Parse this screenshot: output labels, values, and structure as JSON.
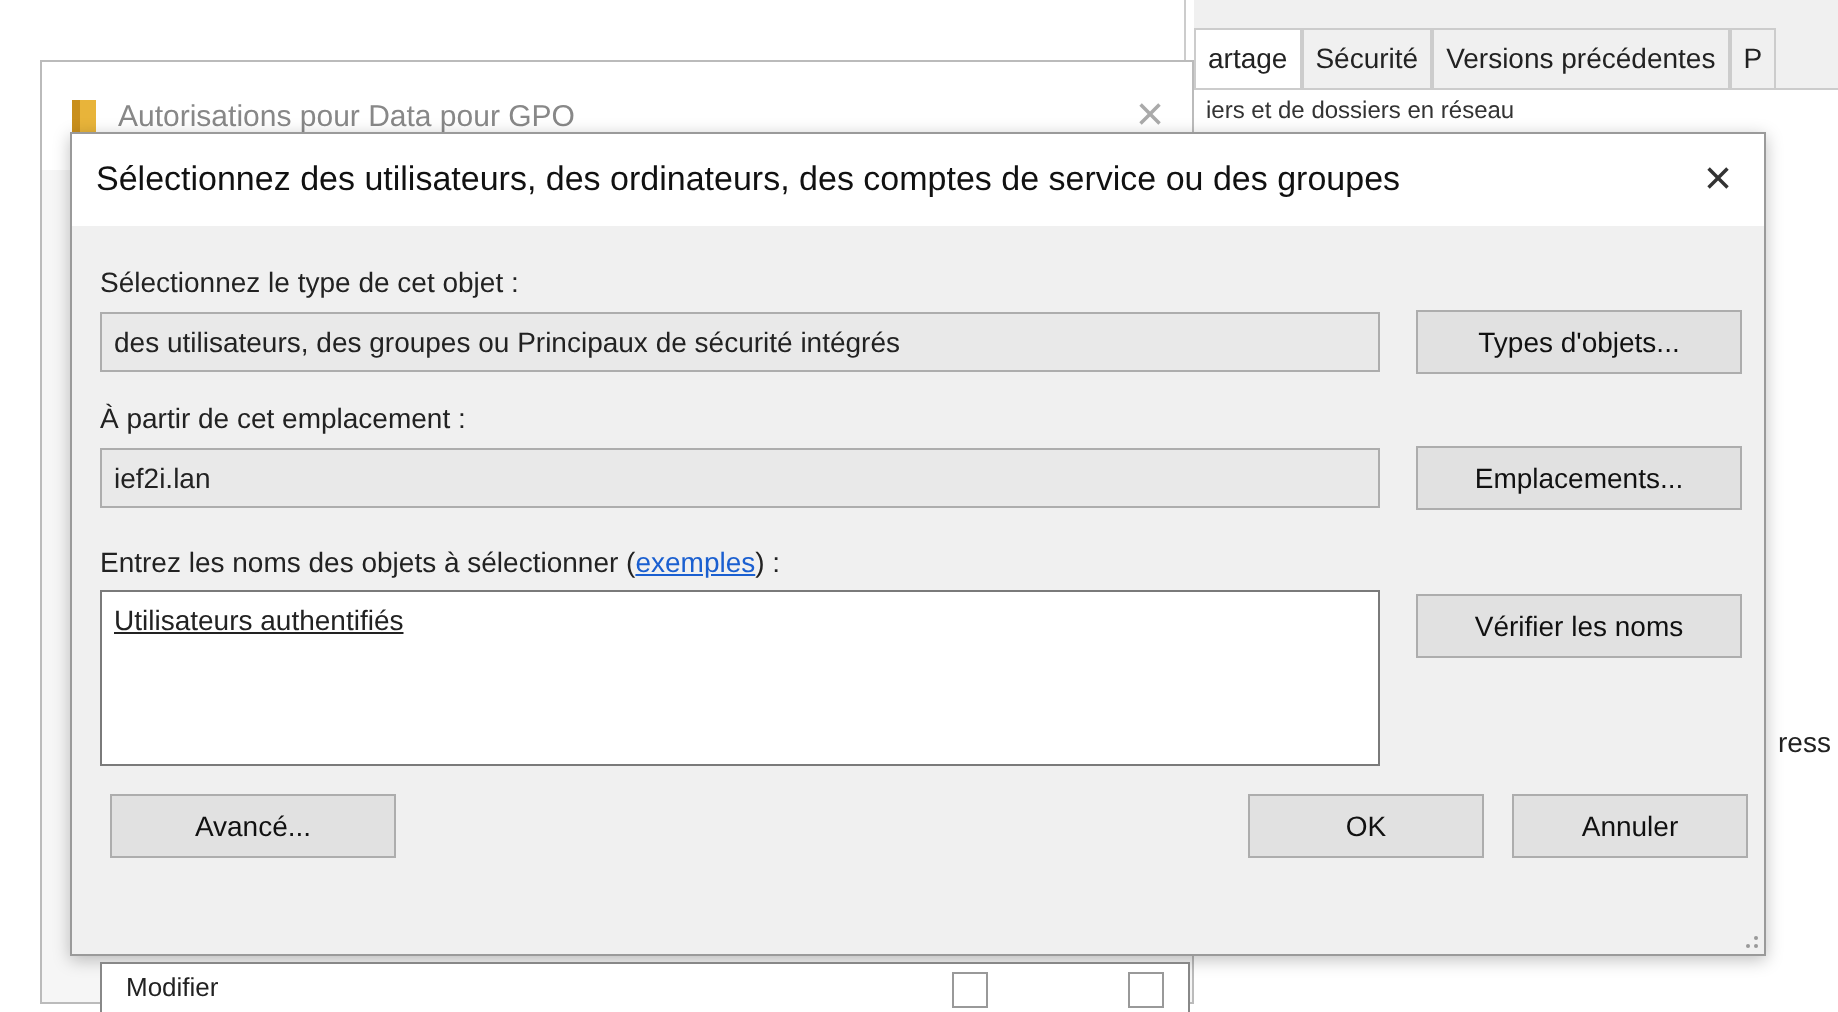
{
  "back_window": {
    "list_item": "Modifier",
    "checkboxes": [
      {
        "checked": false
      },
      {
        "checked": false
      }
    ]
  },
  "properties_window": {
    "tabs": [
      {
        "label": "artage",
        "selected": true
      },
      {
        "label": "Sécurité",
        "selected": false
      },
      {
        "label": "Versions précédentes",
        "selected": false
      },
      {
        "label": "P",
        "selected": false
      }
    ],
    "subtitle": "iers et de dossiers en réseau",
    "side_text": "ress"
  },
  "permissions_window": {
    "title": "Autorisations pour Data pour GPO",
    "close": "×"
  },
  "dialog": {
    "title": "Sélectionnez des utilisateurs, des ordinateurs, des comptes de service ou des groupes",
    "close": "×",
    "type_label": "Sélectionnez le type de cet objet :",
    "type_value": "des utilisateurs, des groupes ou Principaux de sécurité intégrés",
    "type_button": "Types d'objets...",
    "location_label": "À partir de cet emplacement :",
    "location_value": "ief2i.lan",
    "location_button": "Emplacements...",
    "names_label": "Entrez les noms des objets à sélectionner (",
    "names_link": "exemples",
    "names_label_end": ") :",
    "names_value": "Utilisateurs authentifiés",
    "check_button": "Vérifier les noms",
    "advanced_button": "Avancé...",
    "ok_button": "OK",
    "cancel_button": "Annuler"
  }
}
